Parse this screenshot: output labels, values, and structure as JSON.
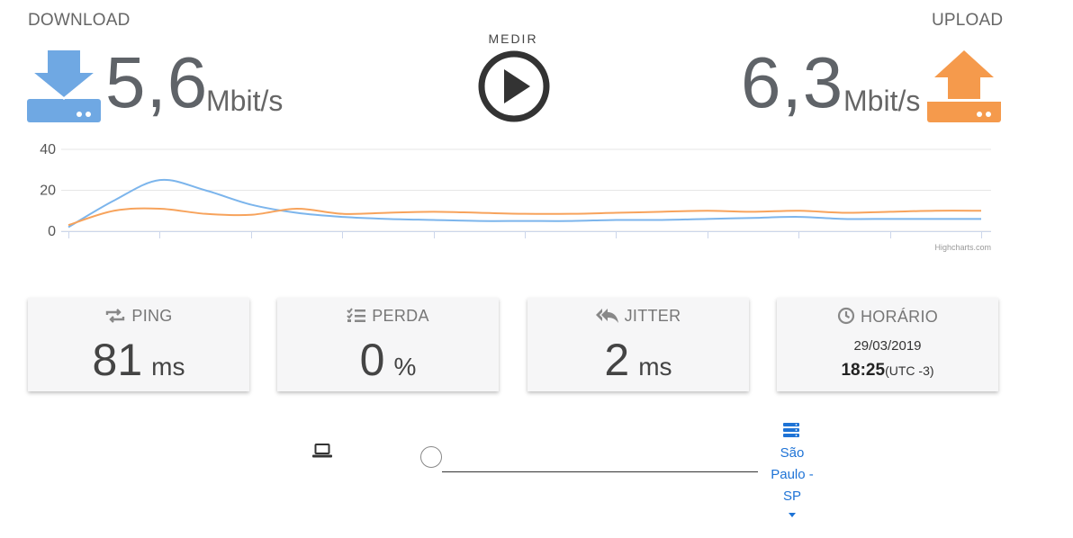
{
  "download": {
    "label": "DOWNLOAD",
    "value": "5,6",
    "unit": "Mbit/s",
    "icon": "download-icon",
    "color": "#6fa8e3"
  },
  "upload": {
    "label": "UPLOAD",
    "value": "6,3",
    "unit": "Mbit/s",
    "icon": "upload-icon",
    "color": "#f59a4c"
  },
  "measure": {
    "label": "MEDIR",
    "icon": "play-icon"
  },
  "chart_data": {
    "type": "line",
    "y_ticks": [
      "40",
      "20",
      "0"
    ],
    "ylim": [
      0,
      40
    ],
    "x": [
      0,
      1,
      2,
      3,
      4,
      5,
      6,
      7,
      8,
      9,
      10,
      11,
      12,
      13,
      14,
      15,
      16,
      17,
      18,
      19,
      20
    ],
    "credit": "Highcharts.com",
    "series": [
      {
        "values": [
          2,
          15,
          25,
          20,
          13,
          9,
          7,
          6,
          5.5,
          5,
          5,
          5,
          5.5,
          5.5,
          6,
          6.5,
          7,
          6,
          6,
          6,
          6
        ],
        "color": "#7cb5ec"
      },
      {
        "values": [
          3,
          10,
          11,
          8.5,
          8,
          11,
          8.5,
          9,
          9.5,
          9,
          8.5,
          8.5,
          9,
          9.5,
          10,
          9.5,
          10,
          9,
          9.5,
          10,
          10
        ],
        "color": "#f7a35c"
      }
    ]
  },
  "cards": {
    "ping": {
      "title": "PING",
      "value": "81",
      "unit": "ms",
      "icon": "repeat-icon"
    },
    "perda": {
      "title": "PERDA",
      "value": "0",
      "unit": "%",
      "icon": "checklist-icon"
    },
    "jitter": {
      "title": "JITTER",
      "value": "2",
      "unit": "ms",
      "icon": "reply-all-icon"
    },
    "horario": {
      "title": "HORÁRIO",
      "date": "29/03/2019",
      "time": "18:25",
      "tz": "(UTC -3)",
      "icon": "clock-icon"
    }
  },
  "connection": {
    "client_icon": "laptop-icon",
    "server_icon": "server-icon",
    "server_name": "São Paulo - SP",
    "link_color": "#1e73d6"
  }
}
